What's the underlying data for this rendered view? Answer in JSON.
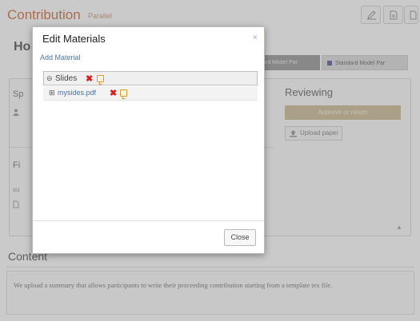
{
  "page": {
    "title": "Contribution",
    "subtitle": "Parallel",
    "how_heading": "Ho",
    "tags": [
      {
        "label": "ard Model Par"
      },
      {
        "label": "Standard Model Par"
      }
    ],
    "sp_label": "Sp",
    "fi_label": "Fi",
    "fi_sub": "su",
    "reviewing": {
      "title": "Reviewing",
      "submit_label": "Approve or return",
      "upload_label": "Upload paper"
    },
    "content": {
      "heading": "Content",
      "text": "We upload a summary that allows participants to write their proceeding contribution starting from a template tex file."
    }
  },
  "modal": {
    "title": "Edit Materials",
    "close_icon": "×",
    "add_material": "Add Material",
    "tree": {
      "folder": {
        "toggle": "⊖",
        "label": "Slides"
      },
      "file": {
        "toggle": "⊞",
        "label": "mysides.pdf"
      }
    },
    "close_button": "Close"
  },
  "colors": {
    "accent": "#c75f2f",
    "link": "#4a7aa8",
    "delete": "#d42222",
    "edit": "#d89a2a"
  },
  "icons": [
    "pencil-icon",
    "pdf-icon",
    "file-icon",
    "user-icon",
    "file-icon",
    "upload-icon",
    "chevron-up-icon",
    "close-icon",
    "collapse-icon",
    "expand-icon",
    "delete-icon",
    "edit-icon"
  ]
}
